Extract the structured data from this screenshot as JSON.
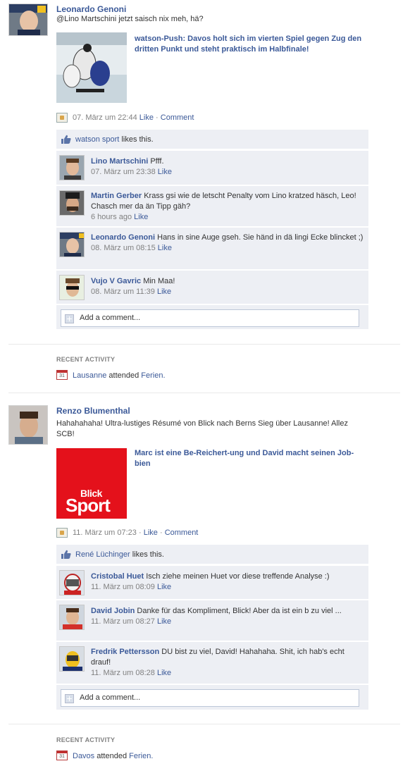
{
  "story1": {
    "author": "Leonardo Genoni",
    "text": "@Lino Martschini jetzt saisch nix meh, hä?",
    "attachment_title": "watson-Push: Davos holt sich im vierten Spiel gegen Zug den dritten Punkt und steht praktisch im Halbfinale!",
    "timestamp": "07. März um 22:44",
    "like_label": "Like",
    "sep": "·",
    "comment_label": "Comment",
    "likes_name": "watson sport",
    "likes_suffix": "likes this.",
    "comments": [
      {
        "name": "Lino Martschini",
        "text": "Pfff.",
        "time": "07. März um 23:38",
        "like": "Like"
      },
      {
        "name": "Martin Gerber",
        "text": "Krass gsi wie de letscht Penalty vom Lino kratzed häsch, Leo! Chasch mer da än Tipp gäh?",
        "time": "6 hours ago",
        "like": "Like"
      },
      {
        "name": "Leonardo Genoni",
        "text": "Hans in sine Auge gseh. Sie händ in dä lingi Ecke blincket ;)",
        "time": "08. März um 08:15",
        "like": "Like"
      },
      {
        "name": "Vujo V Gavric",
        "text": "Min Maa!",
        "time": "08. März um 11:39",
        "like": "Like"
      }
    ],
    "add_comment": "Add a comment..."
  },
  "activity1": {
    "label": "RECENT ACTIVITY",
    "cal_day": "31",
    "subject": "Lausanne",
    "verb": "attended",
    "object": "Ferien."
  },
  "story2": {
    "author": "Renzo Blumenthal",
    "text": "Hahahahaha! Ultra-lustiges Résumé von Blick nach Berns Sieg über Lausanne! Allez SCB!",
    "attachment_title": "Marc ist eine Be-Reichert-ung und David macht seinen Job-bien",
    "logo_line1": "Blick",
    "logo_line2": "Sport",
    "timestamp": "11. März um 07:23",
    "like_label": "Like",
    "sep": "·",
    "comment_label": "Comment",
    "likes_name": "René Lüchinger",
    "likes_suffix": "likes this.",
    "comments": [
      {
        "name": "Cristobal Huet",
        "text": "Isch ziehe meinen Huet vor diese treffende Analyse :)",
        "time": "11. März um 08:09",
        "like": "Like"
      },
      {
        "name": "David Jobin",
        "text": "Danke für das Kompliment, Blick! Aber da ist ein b zu viel ...",
        "time": "11. März um 08:27",
        "like": "Like"
      },
      {
        "name": "Fredrik Pettersson",
        "text": "DU bist zu viel, David! Hahahaha. Shit, ich hab's echt drauf!",
        "time": "11. März um 08:28",
        "like": "Like"
      }
    ],
    "add_comment": "Add a comment..."
  },
  "activity2": {
    "label": "RECENT ACTIVITY",
    "cal_day": "31",
    "subject": "Davos",
    "verb": "attended",
    "object": "Ferien."
  },
  "colors": {
    "link": "#3b5998",
    "ufi_bg": "#edeff4",
    "blick_red": "#e4111b"
  }
}
